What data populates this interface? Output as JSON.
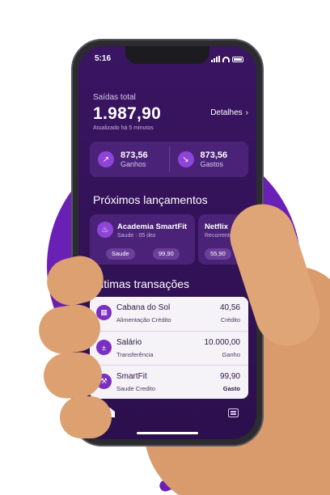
{
  "status_bar": {
    "time": "5:16"
  },
  "summary": {
    "label": "Saídas total",
    "total": "1.987,90",
    "updated": "Atualizado há 5 minutos",
    "details_label": "Detalhes",
    "income": {
      "value": "873,56",
      "label": "Ganhos"
    },
    "expense": {
      "value": "873,56",
      "label": "Gastos"
    }
  },
  "upcoming": {
    "title": "Próximos lançamentos",
    "items": [
      {
        "name": "Academia SmartFit",
        "subtitle": "Saude · 05 dez",
        "tag": "Saude",
        "amount": "99,90"
      },
      {
        "name": "Netflix",
        "subtitle": "Recorrente · 0",
        "amount": "55,90"
      }
    ]
  },
  "transactions": {
    "title": "Últimas transações",
    "items": [
      {
        "name": "Cabana do Sol",
        "category": "Alimentação",
        "method": "Crédito",
        "amount": "40,56",
        "type": "Crédito",
        "icon": "shop-icon"
      },
      {
        "name": "Salário",
        "category": "Transferência",
        "amount": "10.000,00",
        "type": "Ganho",
        "icon": "transfer-icon"
      },
      {
        "name": "SmartFit",
        "category": "Saude",
        "method": "Credito",
        "amount": "99,90",
        "type": "Gasto",
        "icon": "dumbbell-icon"
      }
    ]
  },
  "colors": {
    "brand": "#6a1fb5",
    "screen_bg": "#3a1562",
    "card_bg": "#4a2278",
    "accent_icon": "#8e44d8",
    "tx_card_bg": "#f5f2f8"
  }
}
